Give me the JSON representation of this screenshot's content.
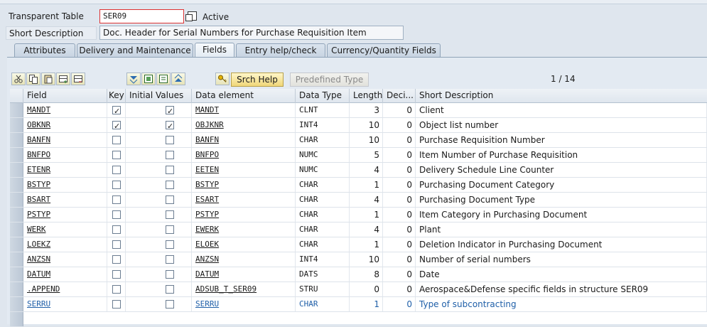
{
  "header": {
    "table_label": "Transparent Table",
    "table_value": "SER09",
    "status": "Active",
    "desc_label": "Short Description",
    "desc_value": "Doc. Header for Serial Numbers for Purchase Requisition Item"
  },
  "tabs": [
    {
      "label": "Attributes"
    },
    {
      "label": "Delivery and Maintenance"
    },
    {
      "label": "Fields"
    },
    {
      "label": "Entry help/check"
    },
    {
      "label": "Currency/Quantity Fields"
    }
  ],
  "toolbar": {
    "srch_help_label": "Srch Help",
    "predefined_type_label": "Predefined Type",
    "pager": "1 / 14"
  },
  "columns": [
    "Field",
    "Key",
    "Initial Values",
    "Data element",
    "Data Type",
    "Length",
    "Deci...",
    "Short Description"
  ],
  "rows": [
    {
      "field": "MANDT",
      "key": true,
      "initial": true,
      "element": "MANDT",
      "type": "CLNT",
      "length": "3",
      "deci": "0",
      "desc": "Client"
    },
    {
      "field": "OBKNR",
      "key": true,
      "initial": true,
      "element": "OBJKNR",
      "type": "INT4",
      "length": "10",
      "deci": "0",
      "desc": "Object list number"
    },
    {
      "field": "BANFN",
      "key": false,
      "initial": false,
      "element": "BANFN",
      "type": "CHAR",
      "length": "10",
      "deci": "0",
      "desc": "Purchase Requisition Number"
    },
    {
      "field": "BNFPO",
      "key": false,
      "initial": false,
      "element": "BNFPO",
      "type": "NUMC",
      "length": "5",
      "deci": "0",
      "desc": "Item Number of Purchase Requisition"
    },
    {
      "field": "ETENR",
      "key": false,
      "initial": false,
      "element": "EETEN",
      "type": "NUMC",
      "length": "4",
      "deci": "0",
      "desc": "Delivery Schedule Line Counter"
    },
    {
      "field": "BSTYP",
      "key": false,
      "initial": false,
      "element": "BSTYP",
      "type": "CHAR",
      "length": "1",
      "deci": "0",
      "desc": "Purchasing Document Category"
    },
    {
      "field": "BSART",
      "key": false,
      "initial": false,
      "element": "ESART",
      "type": "CHAR",
      "length": "4",
      "deci": "0",
      "desc": "Purchasing Document Type"
    },
    {
      "field": "PSTYP",
      "key": false,
      "initial": false,
      "element": "PSTYP",
      "type": "CHAR",
      "length": "1",
      "deci": "0",
      "desc": "Item Category in Purchasing Document"
    },
    {
      "field": "WERK",
      "key": false,
      "initial": false,
      "element": "EWERK",
      "type": "CHAR",
      "length": "4",
      "deci": "0",
      "desc": "Plant"
    },
    {
      "field": "LOEKZ",
      "key": false,
      "initial": false,
      "element": "ELOEK",
      "type": "CHAR",
      "length": "1",
      "deci": "0",
      "desc": "Deletion Indicator in Purchasing Document"
    },
    {
      "field": "ANZSN",
      "key": false,
      "initial": false,
      "element": "ANZSN",
      "type": "INT4",
      "length": "10",
      "deci": "0",
      "desc": "Number of serial numbers"
    },
    {
      "field": "DATUM",
      "key": false,
      "initial": false,
      "element": "DATUM",
      "type": "DATS",
      "length": "8",
      "deci": "0",
      "desc": "Date"
    },
    {
      "field": ".APPEND",
      "key": false,
      "initial": false,
      "element": "ADSUB_T_SER09",
      "type": "STRU",
      "length": "0",
      "deci": "0",
      "desc": "Aerospace&Defense specific fields in structure SER09"
    },
    {
      "field": "SERRU",
      "key": false,
      "initial": false,
      "element": "SERRU",
      "type": "CHAR",
      "length": "1",
      "deci": "0",
      "desc": "Type of subcontracting",
      "highlight": true
    }
  ]
}
